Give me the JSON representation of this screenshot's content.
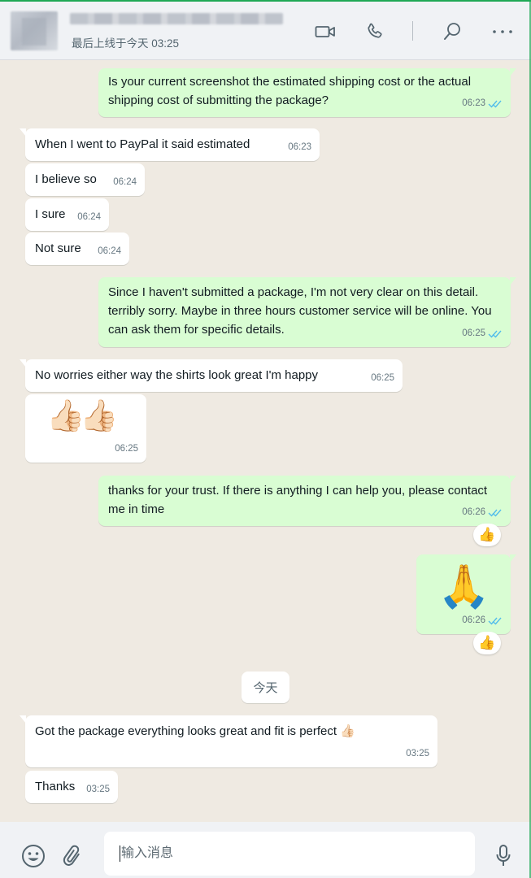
{
  "header": {
    "contact_status": "最后上线于今天 03:25",
    "icons": [
      "video-call-icon",
      "voice-call-icon",
      "search-icon",
      "menu-icon"
    ]
  },
  "colors": {
    "accent": "#1fa855",
    "outgoing_bubble": "#d9fdd3",
    "incoming_bubble": "#ffffff",
    "read_ticks": "#53bdeb",
    "chat_background": "#efeae2"
  },
  "messages": [
    {
      "dir": "out",
      "text": "Is your current screenshot the estimated shipping cost or the actual shipping cost of submitting the package?",
      "time": "06:23"
    },
    {
      "dir": "in",
      "text": "When I went to PayPal it said estimated",
      "time": "06:23"
    },
    {
      "dir": "in",
      "text": "I believe so",
      "time": "06:24"
    },
    {
      "dir": "in",
      "text": "I sure",
      "time": "06:24"
    },
    {
      "dir": "in",
      "text": "Not sure",
      "time": "06:24"
    },
    {
      "dir": "out",
      "text": "Since I haven't submitted a package, I'm not very clear on this detail. terribly sorry. Maybe in three hours customer service will be online. You can ask them for specific details.",
      "time": "06:25"
    },
    {
      "dir": "in",
      "text": "No worries either way the shirts look great I'm happy",
      "time": "06:25"
    },
    {
      "dir": "in",
      "emoji": "👍🏻👍🏻",
      "time": "06:25"
    },
    {
      "dir": "out",
      "text": "thanks for your trust. If there is anything I can help you, please contact me in time",
      "time": "06:26",
      "reaction": "👍"
    },
    {
      "dir": "out",
      "emoji": "🙏",
      "time": "06:26",
      "reaction": "👍"
    },
    {
      "dir": "in",
      "text": "Got the package everything looks great and fit is perfect 👍🏻",
      "time": "03:25"
    },
    {
      "dir": "in",
      "text": "Thanks",
      "time": "03:25"
    }
  ],
  "date_divider": "今天",
  "composer": {
    "placeholder": "输入消息",
    "icons": [
      "emoji-icon",
      "attach-icon",
      "microphone-icon"
    ]
  }
}
